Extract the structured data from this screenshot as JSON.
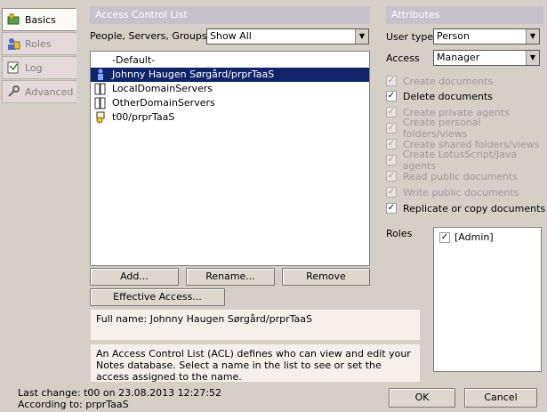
{
  "sidebar": {
    "tabs": [
      {
        "label": "Basics",
        "icon": "key-icon"
      },
      {
        "label": "Roles",
        "icon": "roles-icon"
      },
      {
        "label": "Log",
        "icon": "log-icon"
      },
      {
        "label": "Advanced",
        "icon": "advanced-icon"
      }
    ]
  },
  "acl": {
    "header": "Access Control List",
    "filter_label": "People, Servers, Groups",
    "filter_value": "Show All",
    "entries": [
      {
        "name": "-Default-",
        "icon": ""
      },
      {
        "name": "Johnny Haugen Sørgård/prprTaaS",
        "icon": "person-icon",
        "selected": true
      },
      {
        "name": "LocalDomainServers",
        "icon": "server-group-icon"
      },
      {
        "name": "OtherDomainServers",
        "icon": "server-group-icon"
      },
      {
        "name": "t00/prprTaaS",
        "icon": "server-icon"
      }
    ],
    "add_label": "Add...",
    "rename_label": "Rename...",
    "remove_label": "Remove",
    "effective_label": "Effective Access...",
    "full_name": "Full name: Johnny Haugen Sørgård/prprTaaS",
    "description": "An Access Control List (ACL) defines who can view and edit your Notes database.  Select a name in the list to see or set the access assigned to the name."
  },
  "attributes": {
    "header": "Attributes",
    "user_type_label": "User type",
    "user_type_value": "Person",
    "access_label": "Access",
    "access_value": "Manager",
    "options": [
      {
        "label": "Create documents",
        "checked": true,
        "enabled": false
      },
      {
        "label": "Delete documents",
        "checked": true,
        "enabled": true
      },
      {
        "label": "Create private agents",
        "checked": true,
        "enabled": false
      },
      {
        "label": "Create personal folders/views",
        "checked": true,
        "enabled": false
      },
      {
        "label": "Create shared folders/views",
        "checked": true,
        "enabled": false
      },
      {
        "label": "Create LotusScript/Java agents",
        "checked": true,
        "enabled": false
      },
      {
        "label": "Read public documents",
        "checked": true,
        "enabled": false
      },
      {
        "label": "Write public documents",
        "checked": true,
        "enabled": false
      },
      {
        "label": "Replicate or copy documents",
        "checked": true,
        "enabled": true
      }
    ],
    "roles_label": "Roles",
    "roles": [
      {
        "label": "[Admin]",
        "checked": true
      }
    ]
  },
  "footer": {
    "last_change": "Last change: t00 on 23.08.2013 12:27:52",
    "according_to": "According to: prprTaaS",
    "ok_label": "OK",
    "cancel_label": "Cancel"
  }
}
